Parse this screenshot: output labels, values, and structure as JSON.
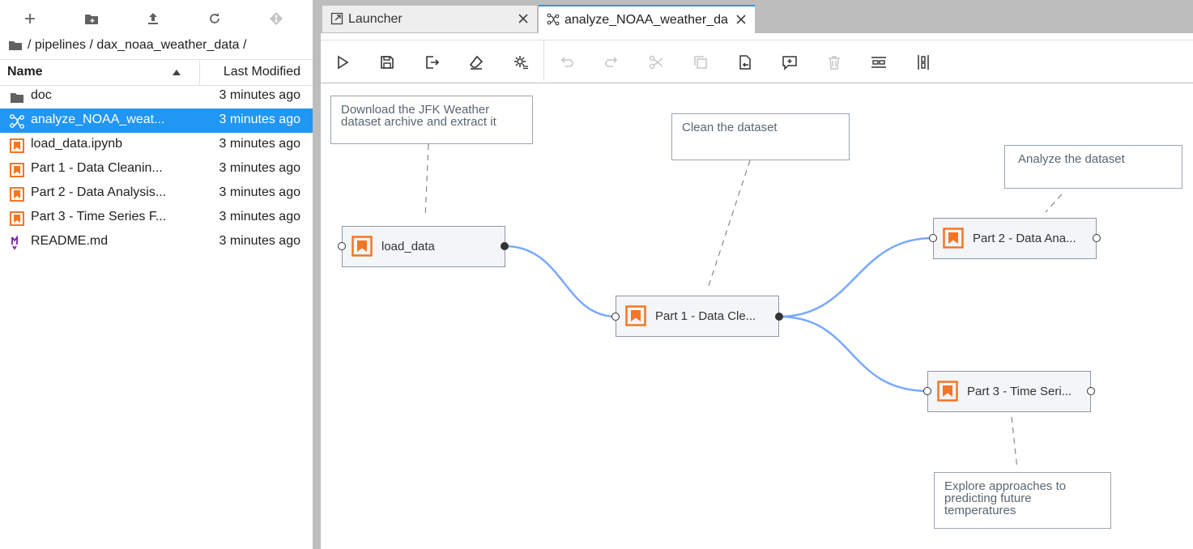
{
  "file_browser": {
    "toolbar": [
      "new-launcher",
      "new-folder",
      "upload",
      "refresh",
      "git-clone"
    ],
    "breadcrumb": "/ pipelines / dax_noaa_weather_data /",
    "header": {
      "name": "Name",
      "modified": "Last Modified"
    },
    "files": [
      {
        "name": "doc",
        "modified": "3 minutes ago",
        "icon": "folder-icon"
      },
      {
        "name": "analyze_NOAA_weat...",
        "modified": "3 minutes ago",
        "icon": "pipeline-icon",
        "selected": true
      },
      {
        "name": "load_data.ipynb",
        "modified": "3 minutes ago",
        "icon": "notebook-icon"
      },
      {
        "name": "Part 1 - Data Cleanin...",
        "modified": "3 minutes ago",
        "icon": "notebook-icon"
      },
      {
        "name": "Part 2 - Data Analysis...",
        "modified": "3 minutes ago",
        "icon": "notebook-icon"
      },
      {
        "name": "Part 3 - Time Series F...",
        "modified": "3 minutes ago",
        "icon": "notebook-icon"
      },
      {
        "name": "README.md",
        "modified": "3 minutes ago",
        "icon": "markdown-icon"
      }
    ]
  },
  "tabs": [
    {
      "label": "Launcher",
      "icon": "launcher-icon"
    },
    {
      "label": "analyze_NOAA_weather_da",
      "icon": "pipeline-icon",
      "active": true
    }
  ],
  "pipeline": {
    "nodes": [
      {
        "label": "load_data"
      },
      {
        "label": "Part 1 - Data Cle..."
      },
      {
        "label": "Part 2 - Data Ana..."
      },
      {
        "label": "Part 3 - Time Seri..."
      }
    ],
    "comments": [
      {
        "text": "Download the JFK Weather dataset archive and extract it"
      },
      {
        "text": "Clean the dataset"
      },
      {
        "text": "Analyze the dataset"
      },
      {
        "text": "Explore approaches to predicting future temperatures"
      }
    ],
    "colors": {
      "link": "#78a9ff",
      "notebook_icon": "#f37626",
      "selected_row": "#2196f3"
    }
  }
}
